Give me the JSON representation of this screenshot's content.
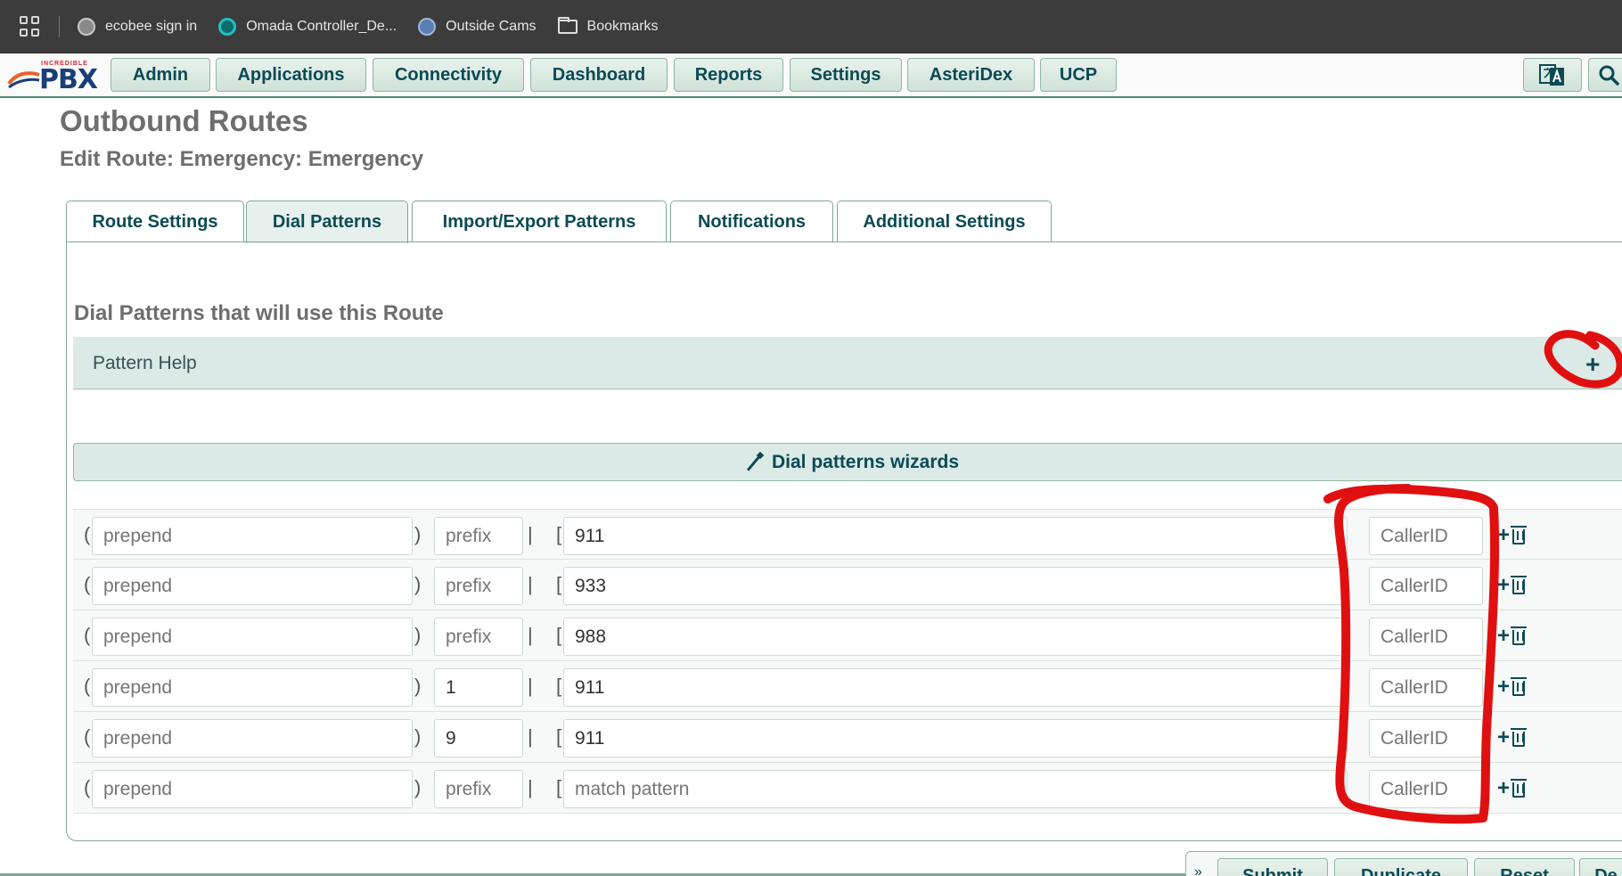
{
  "bookmarks": [
    {
      "label": "ecobee sign in",
      "icon": "globe-icon"
    },
    {
      "label": "Omada Controller_De...",
      "icon": "omada-icon"
    },
    {
      "label": "Outside Cams",
      "icon": "cams-icon"
    },
    {
      "label": "Bookmarks",
      "icon": "folder-icon"
    }
  ],
  "logo": {
    "small_text": "INCREDIBLE",
    "main_text": "PBX"
  },
  "nav": {
    "items": [
      "Admin",
      "Applications",
      "Connectivity",
      "Dashboard",
      "Reports",
      "Settings",
      "AsteriDex",
      "UCP"
    ]
  },
  "page": {
    "title": "Outbound Routes",
    "subtitle": "Edit Route: Emergency: Emergency"
  },
  "tabs": [
    "Route Settings",
    "Dial Patterns",
    "Import/Export Patterns",
    "Notifications",
    "Additional Settings"
  ],
  "active_tab": "Dial Patterns",
  "section": {
    "heading": "Dial Patterns that will use this Route",
    "pattern_help_label": "Pattern Help",
    "wizard_label": "Dial patterns wizards"
  },
  "dial_patterns": [
    {
      "prepend": "",
      "prefix": "",
      "match": "911",
      "callerid": ""
    },
    {
      "prepend": "",
      "prefix": "",
      "match": "933",
      "callerid": ""
    },
    {
      "prepend": "",
      "prefix": "",
      "match": "988",
      "callerid": ""
    },
    {
      "prepend": "",
      "prefix": "1",
      "match": "911",
      "callerid": ""
    },
    {
      "prepend": "",
      "prefix": "9",
      "match": "911",
      "callerid": ""
    },
    {
      "prepend": "",
      "prefix": "",
      "match": "",
      "callerid": ""
    }
  ],
  "placeholders": {
    "prepend": "prepend",
    "prefix": "prefix",
    "match": "match pattern",
    "callerid": "CallerID"
  },
  "brackets": {
    "open_paren": "(",
    "close_paren": ")",
    "pipe": "|",
    "open_square": "["
  },
  "actions": [
    "Submit",
    "Duplicate",
    "Reset",
    "De"
  ],
  "collapse_symbol": "»",
  "colors": {
    "accent": "#0b4a55",
    "panel": "#dbeae6",
    "annotation": "#e01010"
  }
}
